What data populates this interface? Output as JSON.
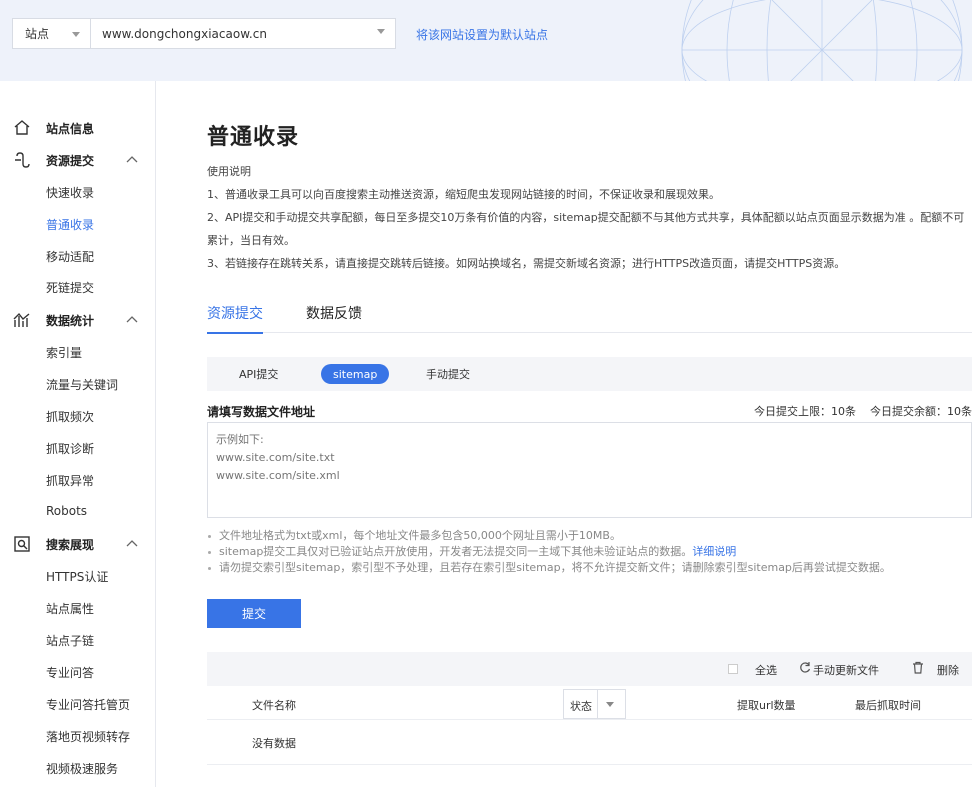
{
  "header": {
    "site_type": "站点",
    "site_url": "www.dongchongxiacaow.cn",
    "set_default_link": "将该网站设置为默认站点"
  },
  "sidebar": {
    "site_info": "站点信息",
    "groups": [
      {
        "label": "资源提交",
        "icon": "resource-submit-icon",
        "items": [
          "快速收录",
          "普通收录",
          "移动适配",
          "死链提交"
        ],
        "active": "普通收录"
      },
      {
        "label": "数据统计",
        "icon": "stats-icon",
        "items": [
          "索引量",
          "流量与关键词",
          "抓取频次",
          "抓取诊断",
          "抓取异常",
          "Robots"
        ]
      },
      {
        "label": "搜索展现",
        "icon": "search-display-icon",
        "items": [
          "HTTPS认证",
          "站点属性",
          "站点子链",
          "专业问答",
          "专业问答托管页",
          "落地页视频转存",
          "视频极速服务"
        ]
      }
    ]
  },
  "main": {
    "title": "普通收录",
    "instructions": [
      "使用说明",
      "1、普通收录工具可以向百度搜索主动推送资源，缩短爬虫发现网站链接的时间，不保证收录和展现效果。",
      "2、API提交和手动提交共享配额，每日至多提交10万条有价值的内容，sitemap提交配额不与其他方式共享，具体配额以站点页面显示数据为准 。配额不可",
      "累计，当日有效。",
      "3、若链接存在跳转关系，请直接提交跳转后链接。如网站换域名，需提交新域名资源；进行HTTPS改造页面，请提交HTTPS资源。"
    ],
    "tabs": [
      "资源提交",
      "数据反馈"
    ],
    "subtabs": [
      "API提交",
      "sitemap",
      "手动提交"
    ],
    "field_label": "请填写数据文件地址",
    "quota_limit": "今日提交上限：10条",
    "quota_remaining": "今日提交余额：10条",
    "textarea_placeholder": "示例如下:\nwww.site.com/site.txt\nwww.site.com/site.xml",
    "notes": {
      "n1": "文件地址格式为txt或xml，每个地址文件最多包含50,000个网址且需小于10MB。",
      "n2": "sitemap提交工具仅对已验证站点开放使用，开发者无法提交同一主域下其他未验证站点的数据。",
      "n2_link": "详细说明",
      "n3": "请勿提交索引型sitemap，索引型不予处理，且若存在索引型sitemap，将不允许提交新文件；请删除索引型sitemap后再尝试提交数据。"
    },
    "submit_label": "提交",
    "table": {
      "select_all": "全选",
      "refresh": "手动更新文件",
      "delete": "删除",
      "col_filename": "文件名称",
      "col_status": "状态",
      "col_url_count": "提取url数量",
      "col_last_crawl": "最后抓取时间",
      "empty": "没有数据"
    }
  },
  "colors": {
    "accent": "#3874e6",
    "header_bg": "#eef2fa"
  }
}
